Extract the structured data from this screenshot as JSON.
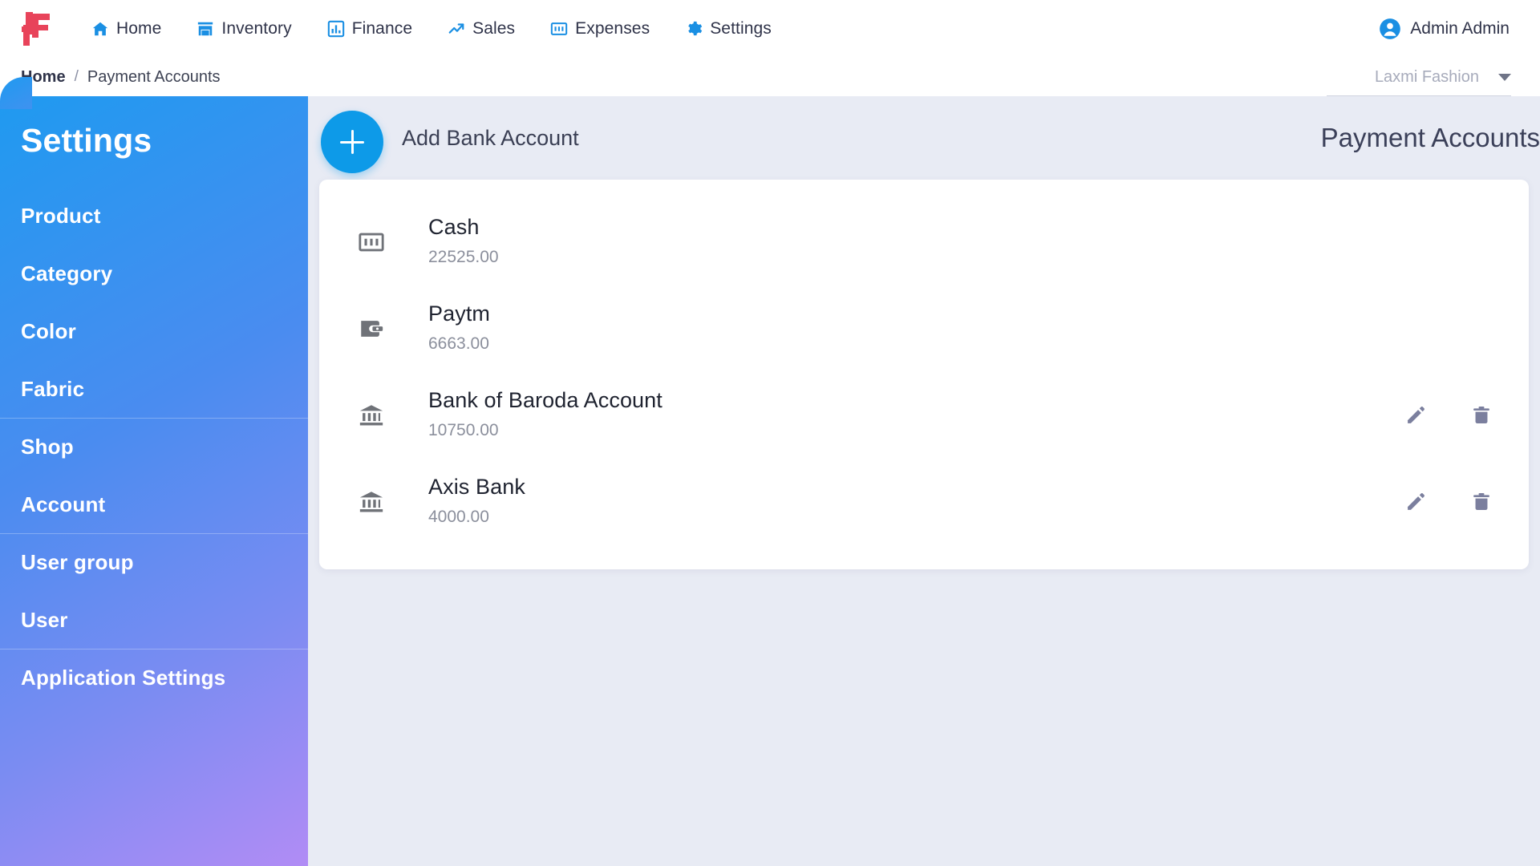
{
  "brand": {
    "logo_text": "LF",
    "logo_color": "#e8435a"
  },
  "topnav": {
    "items": [
      {
        "label": "Home",
        "icon": "home-icon"
      },
      {
        "label": "Inventory",
        "icon": "store-icon"
      },
      {
        "label": "Finance",
        "icon": "bar-chart-icon"
      },
      {
        "label": "Sales",
        "icon": "trending-up-icon"
      },
      {
        "label": "Expenses",
        "icon": "banknote-icon"
      },
      {
        "label": "Settings",
        "icon": "gear-icon"
      }
    ],
    "accent_color": "#1a8fe3",
    "user": {
      "name": "Admin Admin",
      "icon": "account-circle-icon"
    }
  },
  "breadcrumb": {
    "home": "Home",
    "separator": "/",
    "current": "Payment Accounts"
  },
  "shop_selector": {
    "value": "Laxmi Fashion",
    "icon": "chevron-down-icon"
  },
  "sidebar": {
    "title": "Settings",
    "gradient_from": "#1f9af0",
    "gradient_to": "#b18cf5",
    "items": [
      {
        "label": "Product",
        "divider_above": false
      },
      {
        "label": "Category",
        "divider_above": false
      },
      {
        "label": "Color",
        "divider_above": false
      },
      {
        "label": "Fabric",
        "divider_above": false
      },
      {
        "label": "Shop",
        "divider_above": true
      },
      {
        "label": "Account",
        "divider_above": false
      },
      {
        "label": "User group",
        "divider_above": true
      },
      {
        "label": "User",
        "divider_above": false
      },
      {
        "label": "Application Settings",
        "divider_above": true
      }
    ]
  },
  "main": {
    "add_button": {
      "label": "Add Bank Account",
      "icon": "plus-icon",
      "color": "#0d9ae8"
    },
    "page_title": "Payment Accounts",
    "accounts": [
      {
        "name": "Cash",
        "amount": "22525.00",
        "icon": "banknote-icon",
        "has_actions": false
      },
      {
        "name": "Paytm",
        "amount": "6663.00",
        "icon": "wallet-icon",
        "has_actions": false
      },
      {
        "name": "Bank of Baroda Account",
        "amount": "10750.00",
        "icon": "bank-icon",
        "has_actions": true
      },
      {
        "name": "Axis Bank",
        "amount": "4000.00",
        "icon": "bank-icon",
        "has_actions": true
      }
    ],
    "row_actions": {
      "edit_icon": "pencil-icon",
      "delete_icon": "trash-icon",
      "color": "#7b7f9e"
    }
  }
}
